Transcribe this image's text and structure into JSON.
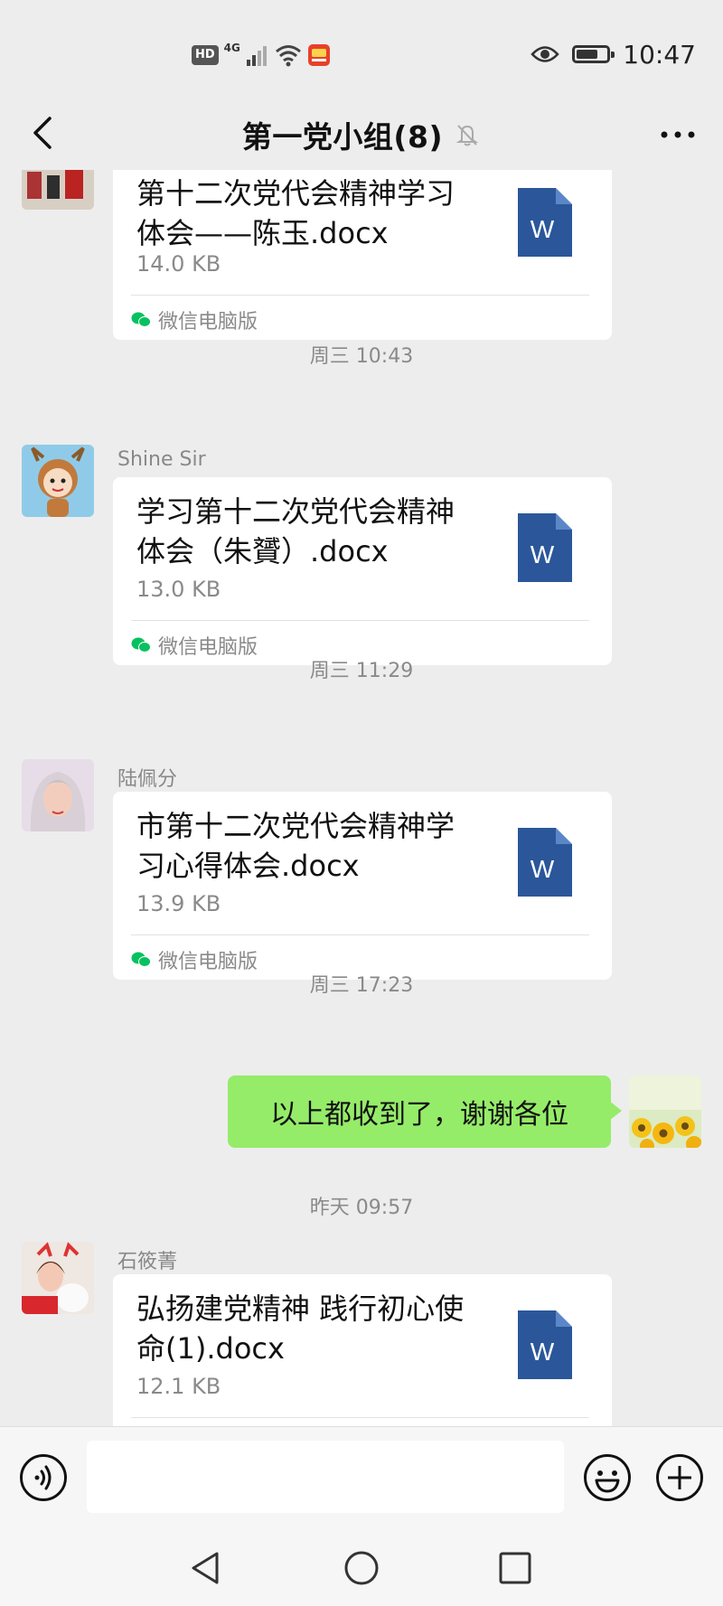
{
  "status_bar": {
    "time": "10:47",
    "hd_label": "HD",
    "network_label": "4G",
    "battery_level": 0.75
  },
  "header": {
    "title": "第一党小组(8)",
    "back_icon": "chevron-left-icon",
    "mute_icon": "bell-off-icon",
    "more_icon": "more-dots-icon"
  },
  "messages": [
    {
      "type": "file",
      "sender": "",
      "file_name": "第十二次党代会精神学习体会——陈玉.docx",
      "file_size": "14.0 KB",
      "source": "微信电脑版"
    },
    {
      "type": "timestamp",
      "text": "周三 10:43"
    },
    {
      "type": "file",
      "sender": "Shine Sir",
      "file_name": "学习第十二次党代会精神体会（朱贇）.docx",
      "file_size": "13.0 KB",
      "source": "微信电脑版"
    },
    {
      "type": "timestamp",
      "text": "周三 11:29"
    },
    {
      "type": "file",
      "sender": "陆佩分",
      "file_name": "市第十二次党代会精神学习心得体会.docx",
      "file_size": "13.9 KB",
      "source": "微信电脑版"
    },
    {
      "type": "timestamp",
      "text": "周三 17:23"
    },
    {
      "type": "text_self",
      "text": "以上都收到了，谢谢各位"
    },
    {
      "type": "timestamp",
      "text": "昨天 09:57"
    },
    {
      "type": "file",
      "sender": "石筱菁",
      "file_name": "弘扬建党精神  践行初心使命(1).docx",
      "file_size": "12.1 KB",
      "source": ""
    }
  ],
  "word_icon_letter": "W",
  "input_bar": {
    "voice_icon": "voice-icon",
    "input_value": "",
    "emoji_icon": "emoji-icon",
    "add_icon": "plus-circle-icon"
  },
  "colors": {
    "background": "#EDEDED",
    "self_bubble": "#95EC69",
    "word_blue": "#2B579A",
    "wechat_green": "#07C160"
  }
}
